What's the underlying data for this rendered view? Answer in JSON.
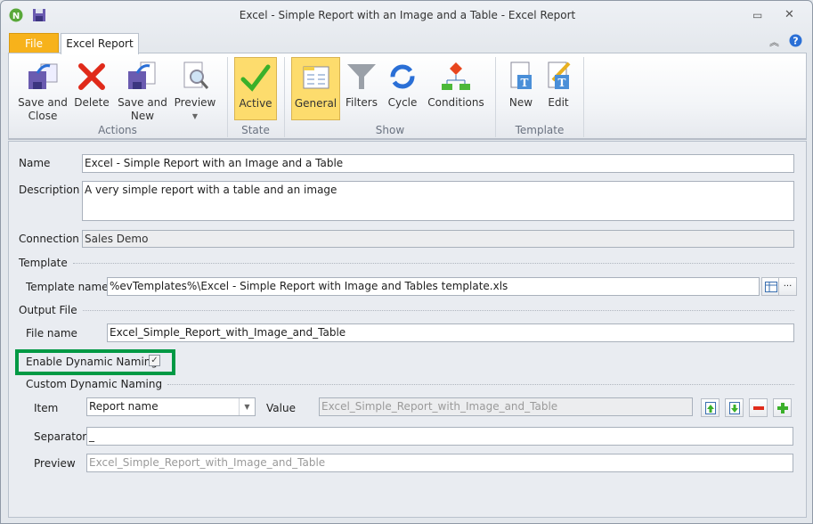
{
  "window": {
    "title": "Excel - Simple Report with an Image and a Table - Excel Report"
  },
  "tabs": [
    {
      "label": "File"
    },
    {
      "label": "Excel Report"
    }
  ],
  "ribbon": {
    "groups": [
      {
        "label": "Actions"
      },
      {
        "label": "State"
      },
      {
        "label": "Show"
      },
      {
        "label": "Template"
      }
    ],
    "buttons": {
      "save_close": "Save and\nClose",
      "delete": "Delete",
      "save_new": "Save and\nNew",
      "preview": "Preview",
      "active": "Active",
      "general": "General",
      "filters": "Filters",
      "cycle": "Cycle",
      "conditions": "Conditions",
      "new": "New",
      "edit": "Edit"
    }
  },
  "form": {
    "name_label": "Name",
    "name_value": "Excel - Simple Report with an Image and a Table",
    "description_label": "Description",
    "description_value": "A very simple report with a table and an image",
    "connection_label": "Connection",
    "connection_value": "Sales Demo",
    "template_section": "Template",
    "template_name_label": "Template name",
    "template_name_value": "%evTemplates%\\Excel - Simple Report with Image and Tables template.xls",
    "output_section": "Output File",
    "file_name_label": "File name",
    "file_name_value": "Excel_Simple_Report_with_Image_and_Table",
    "dynamic_naming_label": "Enable Dynamic Naming",
    "dynamic_naming_checked": true,
    "custom_section": "Custom Dynamic Naming",
    "item_label": "Item",
    "item_value": "Report name",
    "value_label": "Value",
    "value_value": "Excel_Simple_Report_with_Image_and_Table",
    "separator_label": "Separator",
    "separator_value": "_",
    "preview_label": "Preview",
    "preview_value": "Excel_Simple_Report_with_Image_and_Table"
  },
  "colors": {
    "file_tab": "#f5a623",
    "highlight": "#fddc6d",
    "callout": "#009944"
  }
}
